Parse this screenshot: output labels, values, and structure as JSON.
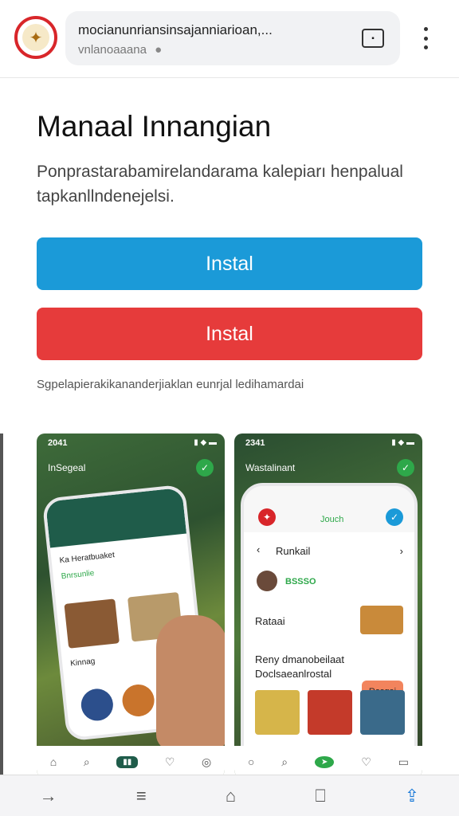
{
  "browser": {
    "url_title": "mocianunriansinsajanniarioan,...",
    "url_subtitle": "vnlanoaaana",
    "icons": {
      "logo": "site-logo",
      "lock": "lock-icon",
      "tabs": "tabs-icon",
      "menu": "kebab-menu-icon"
    }
  },
  "page": {
    "title": "Manaal Innangian",
    "description": "Ponprastarabamirelandarama kalepiarı henpalual tapkanllndenejelsi.",
    "install_primary": "Instal",
    "install_secondary": "Instal",
    "note": "Sgpelapierakikananderjiaklan eunrjal ledihamardai"
  },
  "screenshots": [
    {
      "status_time": "2041",
      "brand": "InSegeal",
      "items": [
        "Ka Heratbuaket",
        "Bnrsunlie",
        "Kinnag"
      ]
    },
    {
      "status_time": "2341",
      "brand": "Wastalinant",
      "app_header": "Jouch",
      "nav_title": "Runkail",
      "profile": "BSSSO",
      "row1": "Rataai",
      "row2_line1": "Reny dmanobeilaat",
      "row2_line2": "Doclsaeanlrostal",
      "cta": "Rasgai"
    }
  ],
  "colors": {
    "primary": "#1b9ad8",
    "danger": "#e63b3b",
    "green": "#2ea84a"
  },
  "bottom_nav": [
    "forward-icon",
    "reader-icon",
    "home-icon",
    "bookmark-icon",
    "share-icon"
  ]
}
